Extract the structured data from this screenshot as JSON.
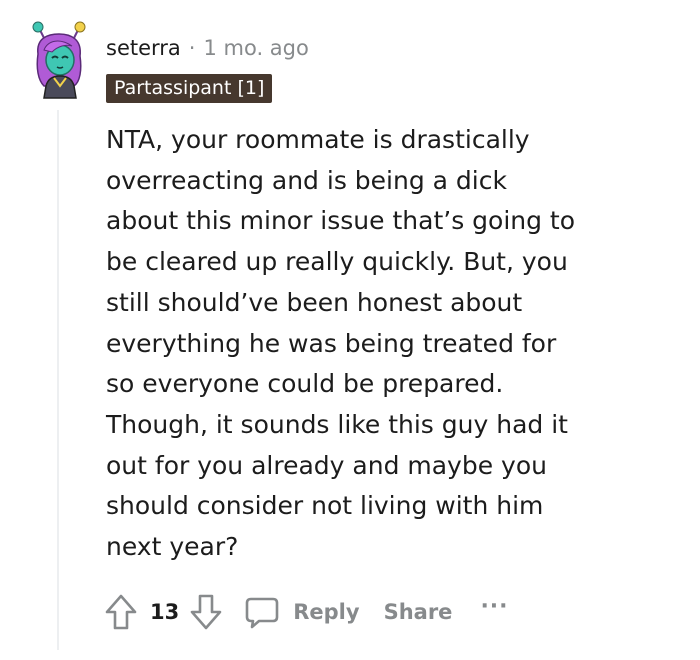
{
  "comment": {
    "username": "seterra",
    "separator": "·",
    "timestamp": "1 mo. ago",
    "flair": "Partassipant [1]",
    "body": "NTA, your roommate is drastically\noverreacting and is being a dick\nabout this minor issue that’s going to\nbe cleared up really quickly. But, you\nstill should’ve been honest about\neverything he was being treated for\nso everyone could be prepared.\nThough, it sounds like this guy had it\nout for you already and maybe you\nshould consider not living with him\nnext year?",
    "vote_count": "13",
    "reply_label": "Reply",
    "share_label": "Share",
    "more_label": "···"
  },
  "icons": {
    "avatar": "avatar",
    "upvote": "upvote-arrow-icon",
    "downvote": "downvote-arrow-icon",
    "reply": "speech-bubble-icon",
    "more": "more-options-icon"
  },
  "colors": {
    "flair_background": "#46382e",
    "muted_text": "#878a8c",
    "thread_line": "#edeff1",
    "avatar_hair": "#b05bd6",
    "avatar_skin": "#3fc7b3"
  }
}
